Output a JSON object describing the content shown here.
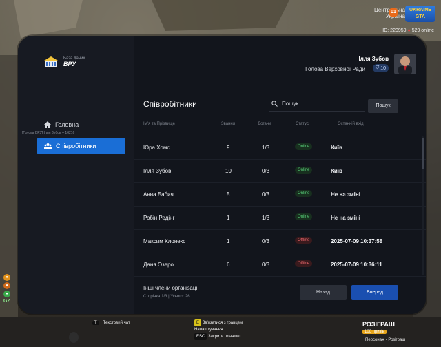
{
  "hud": {
    "region_line1": "Центральна",
    "region_line2": "Україна",
    "region_badge": "01",
    "logo_line1": "UKRAINE",
    "logo_line2": "GTA",
    "player_id": "ID: 220959",
    "online": "529 online"
  },
  "sidebar": {
    "brand_subtitle": "База даних",
    "brand_title": "ВРУ",
    "home_label": "Головна",
    "tag_line": "[Голова ВРУ] Ілля Зубов",
    "tag_id": "10216",
    "staff_label": "Співробітники"
  },
  "user": {
    "name": "Ілля Зубов",
    "role": "Голова Верховної Ради",
    "level": "10"
  },
  "page": {
    "title": "Співробітники",
    "search_placeholder": "Пошук..",
    "search_button": "Пошук"
  },
  "table": {
    "headers": [
      "Ім'я та Прізвище",
      "Звання",
      "Догани",
      "Статус",
      "Останній вхід"
    ],
    "rows": [
      {
        "name": "Юра Хомс",
        "rank": "9",
        "warns": "1/3",
        "status": "Online",
        "last": "Київ"
      },
      {
        "name": "Ілля Зубов",
        "rank": "10",
        "warns": "0/3",
        "status": "Online",
        "last": "Київ"
      },
      {
        "name": "Анна Бабич",
        "rank": "5",
        "warns": "0/3",
        "status": "Online",
        "last": "Не на зміні"
      },
      {
        "name": "Робін Редінг",
        "rank": "1",
        "warns": "1/3",
        "status": "Online",
        "last": "Не на зміні"
      },
      {
        "name": "Максим Клонекс",
        "rank": "1",
        "warns": "0/3",
        "status": "Offline",
        "last": "2025-07-09 10:37:58"
      },
      {
        "name": "Даня Озеро",
        "rank": "6",
        "warns": "0/3",
        "status": "Offline",
        "last": "2025-07-09 10:36:11"
      }
    ]
  },
  "footer": {
    "other_members": "Інші члени організації",
    "pager": "Сторінка 1/3 | Усього: 26",
    "back_button": "Назад",
    "next_button": "Вперед"
  },
  "bottom_hud": {
    "chat_key": "T",
    "chat_label": "Текстовий чат",
    "hint_key1": "E",
    "hint1": "Зв'язатися з гравцем",
    "hint2": "Налаштування",
    "hint_key3": "ESC",
    "hint3": "Закрити планшет",
    "gz": "GZ",
    "raffle_title": "РОЗІГРАШ",
    "raffle_value": "100",
    "raffle_value_label": "призів",
    "raffle_sub": "Персонаж - Розіграш"
  },
  "colors": {
    "accent": "#1a6ed6",
    "next_button": "#1a4fb0",
    "online": "#58d07a",
    "offline": "#f0686e"
  }
}
